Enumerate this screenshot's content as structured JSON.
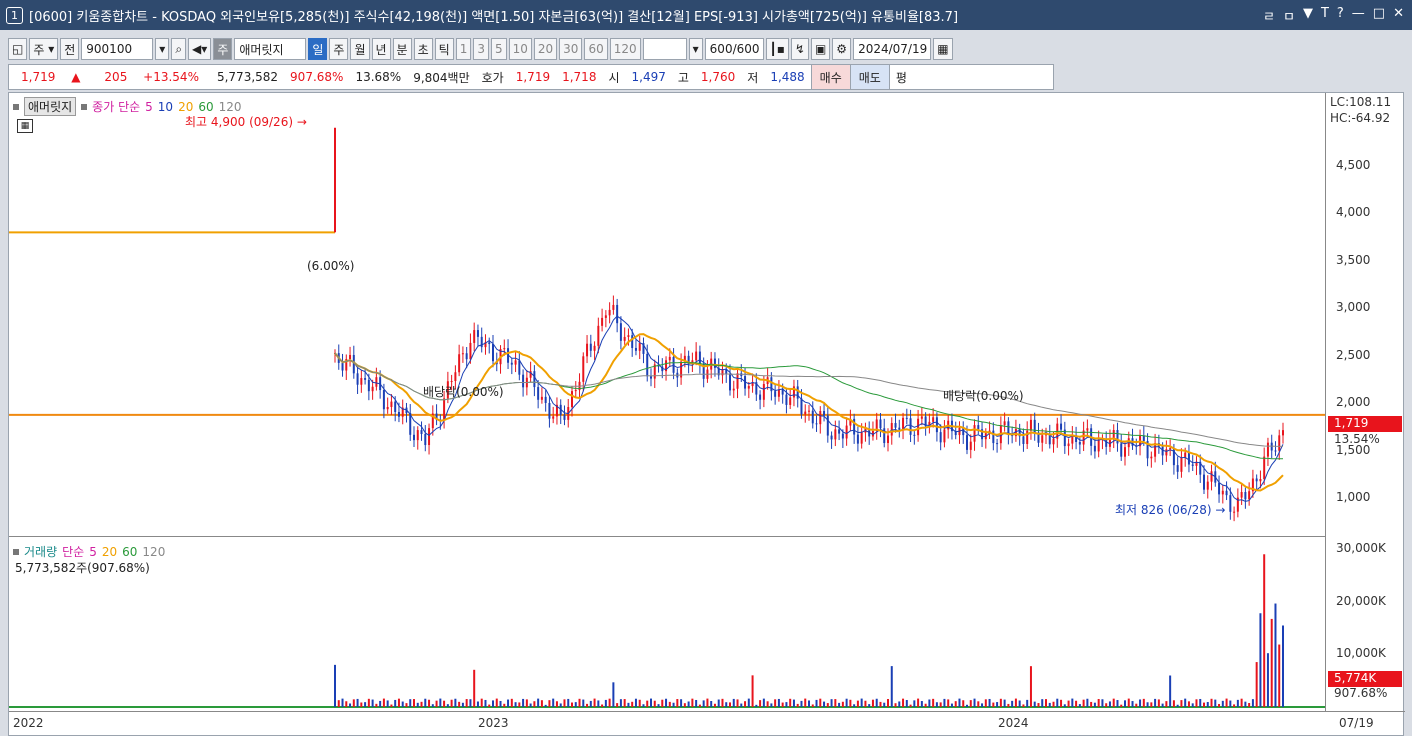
{
  "window": {
    "number": "1",
    "title": "[0600] 키움종합차트 - KOSDAQ 외국인보유[5,285(천)] 주식수[42,198(천)] 액면[1.50] 자본금[63(억)] 결산[12월] EPS[-913] 시가총액[725(억)] 유통비율[83.7]",
    "controls": [
      "ㄹ",
      "ㅁ",
      "▼",
      "T",
      "?",
      "—",
      "□",
      "✕"
    ]
  },
  "toolbar": {
    "period_select": "주",
    "pre_label": "전",
    "code": "900100",
    "name_prefix": "주",
    "stock_name": "애머릿지",
    "periods": [
      "일",
      "주",
      "월",
      "년",
      "분",
      "초",
      "틱"
    ],
    "intervals": [
      "1",
      "3",
      "5",
      "10",
      "20",
      "30",
      "60",
      "120"
    ],
    "count": "600",
    "count_total": "/600",
    "date": "2024/07/19"
  },
  "quote": {
    "price": "1,719",
    "arrow": "▲",
    "change": "205",
    "change_pct": "+13.54%",
    "volume": "5,773,582",
    "vol_ratio": "907.68%",
    "turnover": "13.68%",
    "amount": "9,804백만",
    "hoga_label": "호가",
    "ask": "1,719",
    "bid": "1,718",
    "open_label": "시",
    "open": "1,497",
    "high_label": "고",
    "high": "1,760",
    "low_label": "저",
    "low": "1,488",
    "buy_label": "매수",
    "sell_label": "매도",
    "p_label": "평"
  },
  "legend_price": {
    "name": "애머릿지",
    "ma_label": "종가 단순",
    "ma": [
      "5",
      "10",
      "20",
      "60",
      "120"
    ]
  },
  "legend_vol": {
    "name": "거래량",
    "ma_label": "단순",
    "ma": [
      "5",
      "20",
      "60",
      "120"
    ],
    "value_text": "5,773,582주(907.68%)"
  },
  "annotations": {
    "high": "최고 4,900 (09/26) →",
    "low": "최저 826 (06/28) →",
    "pct1": "(6.00%)",
    "div1": "배당락(0.00%)",
    "div2": "배당락(0.00%)",
    "lc": "LC:108.11",
    "hc": "HC:-64.92",
    "cur_price": "1,719",
    "cur_pct": "13.54%",
    "cur_vol": "5,774K",
    "cur_vol_pct": "907.68%"
  },
  "price_axis": [
    "4,500",
    "4,000",
    "3,500",
    "3,000",
    "2,500",
    "2,000",
    "1,500",
    "1,000"
  ],
  "vol_axis": [
    "30,000K",
    "20,000K",
    "10,000K"
  ],
  "x_axis": [
    "2022",
    "2023",
    "2024",
    "07/19"
  ],
  "colors": {
    "ma5": "#1a3fb5",
    "ma10": "#7b2cbf",
    "ma20": "#f0a000",
    "ma60": "#2a9a3a",
    "ma120": "#888888",
    "up": "#e8141c",
    "down": "#1a3fb5",
    "hline": "#f08a10"
  },
  "chart_data": {
    "type": "candlestick",
    "period": "weekly",
    "price_ylim": [
      826,
      4900
    ],
    "volume_ylim": [
      0,
      30000
    ],
    "volume_unit": "K",
    "reference_line": 1880,
    "weeks": [
      "2022-01",
      "2022-02",
      "2022-03",
      "2022-04",
      "2022-05",
      "2022-06",
      "2022-07",
      "2022-08",
      "2022-09",
      "2022-10",
      "2022-11",
      "2022-12",
      "2023-01",
      "2023-02",
      "2023-03",
      "2023-04",
      "2023-05",
      "2023-06",
      "2023-07",
      "2023-08",
      "2023-09",
      "2023-10",
      "2023-11",
      "2023-12",
      "2024-01",
      "2024-02",
      "2024-03",
      "2024-04",
      "2024-05",
      "2024-06",
      "2024-07"
    ],
    "close": [
      3800,
      3800,
      3800,
      3800,
      3800,
      3800,
      3800,
      3800,
      3800,
      2500,
      2100,
      1600,
      2700,
      2400,
      1800,
      3000,
      2350,
      2450,
      2200,
      2100,
      1700,
      1700,
      1800,
      1650,
      1700,
      1650,
      1600,
      1550,
      1350,
      900,
      1719
    ]
  }
}
